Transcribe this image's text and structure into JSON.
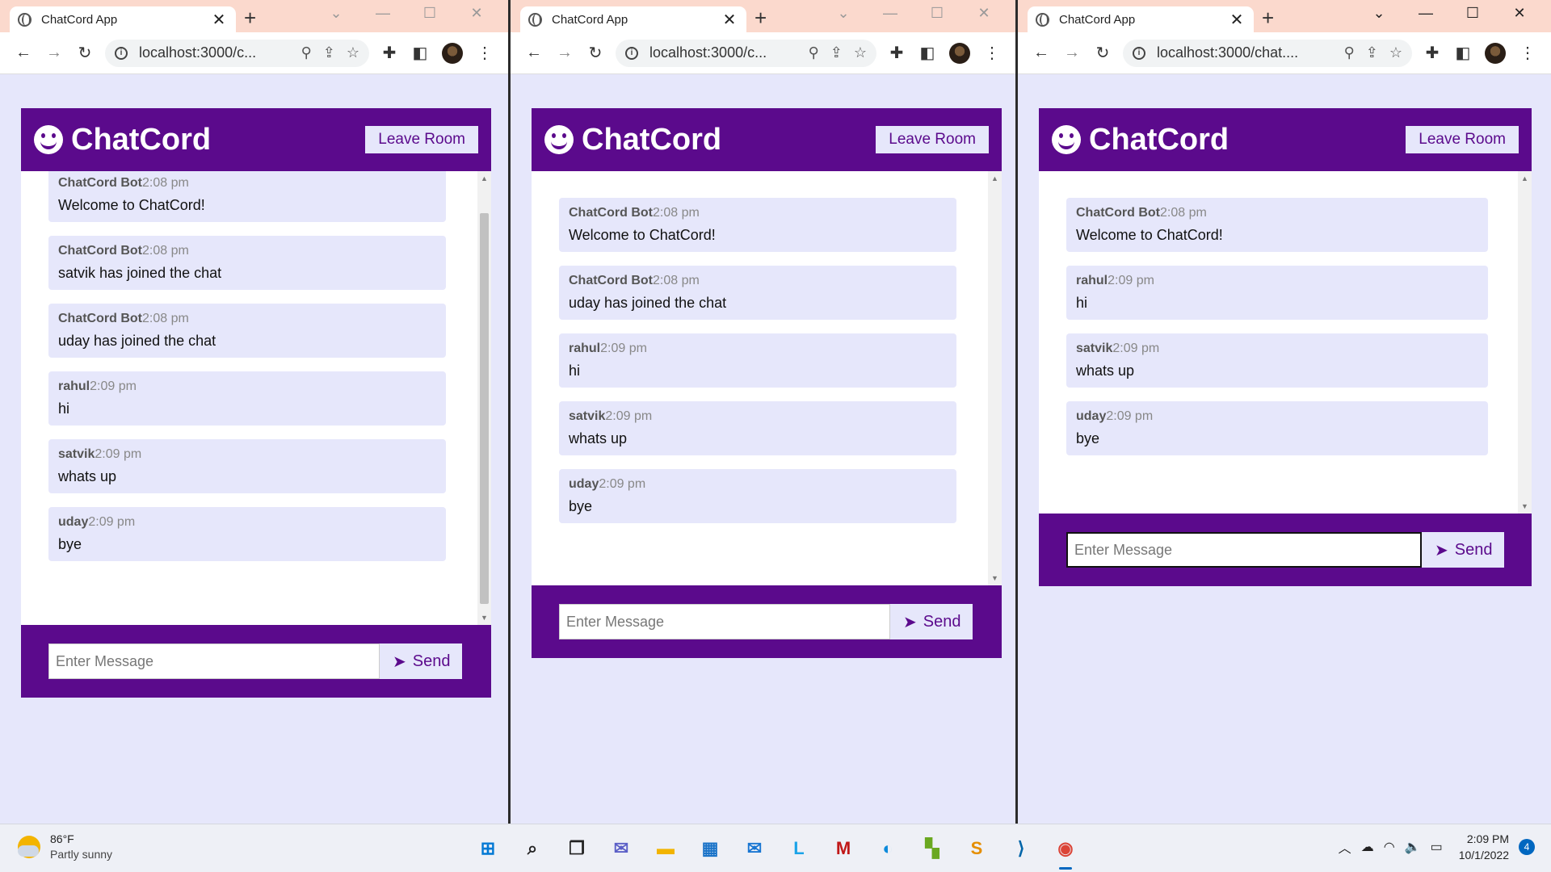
{
  "browser": {
    "tab_title": "ChatCord App",
    "tab_close": "✕",
    "new_tab": "+",
    "windows": [
      {
        "url": "localhost:3000/c..."
      },
      {
        "url": "localhost:3000/c..."
      },
      {
        "url": "localhost:3000/chat...."
      }
    ]
  },
  "app": {
    "brand": "ChatCord",
    "leave_button": "Leave Room",
    "input_placeholder": "Enter Message",
    "send_label": "Send",
    "colors": {
      "primary": "#5b0a8c",
      "light": "#e6e7fb"
    }
  },
  "chats": [
    {
      "messages": [
        {
          "user": "ChatCord Bot",
          "time": "2:08 pm",
          "text": "Welcome to ChatCord!"
        },
        {
          "user": "ChatCord Bot",
          "time": "2:08 pm",
          "text": "satvik has joined the chat"
        },
        {
          "user": "ChatCord Bot",
          "time": "2:08 pm",
          "text": "uday has joined the chat"
        },
        {
          "user": "rahul",
          "time": "2:09 pm",
          "text": "hi"
        },
        {
          "user": "satvik",
          "time": "2:09 pm",
          "text": "whats up"
        },
        {
          "user": "uday",
          "time": "2:09 pm",
          "text": "bye"
        }
      ]
    },
    {
      "messages": [
        {
          "user": "ChatCord Bot",
          "time": "2:08 pm",
          "text": "Welcome to ChatCord!"
        },
        {
          "user": "ChatCord Bot",
          "time": "2:08 pm",
          "text": "uday has joined the chat"
        },
        {
          "user": "rahul",
          "time": "2:09 pm",
          "text": "hi"
        },
        {
          "user": "satvik",
          "time": "2:09 pm",
          "text": "whats up"
        },
        {
          "user": "uday",
          "time": "2:09 pm",
          "text": "bye"
        }
      ]
    },
    {
      "messages": [
        {
          "user": "ChatCord Bot",
          "time": "2:08 pm",
          "text": "Welcome to ChatCord!"
        },
        {
          "user": "rahul",
          "time": "2:09 pm",
          "text": "hi"
        },
        {
          "user": "satvik",
          "time": "2:09 pm",
          "text": "whats up"
        },
        {
          "user": "uday",
          "time": "2:09 pm",
          "text": "bye"
        }
      ]
    }
  ],
  "taskbar": {
    "weather_temp": "86°F",
    "weather_condition": "Partly sunny",
    "time": "2:09 PM",
    "date": "10/1/2022",
    "notification_count": "4",
    "apps": [
      {
        "icon": "windows-start-icon",
        "label": "⊞",
        "color": "#0078d4"
      },
      {
        "icon": "search-icon",
        "label": "⌕",
        "color": "#222222"
      },
      {
        "icon": "task-view-icon",
        "label": "❐",
        "color": "#222222"
      },
      {
        "icon": "teams-chat-icon",
        "label": "✉",
        "color": "#5b5fc7"
      },
      {
        "icon": "file-explorer-icon",
        "label": "▬",
        "color": "#f2b400"
      },
      {
        "icon": "ms-store-icon",
        "label": "▦",
        "color": "#1a73c8"
      },
      {
        "icon": "mail-icon",
        "label": "✉",
        "color": "#1976d2"
      },
      {
        "icon": "l-app-icon",
        "label": "L",
        "color": "#1aa3e8"
      },
      {
        "icon": "mcafee-icon",
        "label": "M",
        "color": "#c01818"
      },
      {
        "icon": "edge-icon",
        "label": "◐",
        "color": "#0c8adb"
      },
      {
        "icon": "colorful-app-icon",
        "label": "▚",
        "color": "#6aa820"
      },
      {
        "icon": "sublime-icon",
        "label": "S",
        "color": "#e58e00"
      },
      {
        "icon": "vscode-icon",
        "label": "⟩",
        "color": "#0065a9"
      },
      {
        "icon": "chrome-icon",
        "label": "◉",
        "color": "#db4437"
      }
    ]
  }
}
